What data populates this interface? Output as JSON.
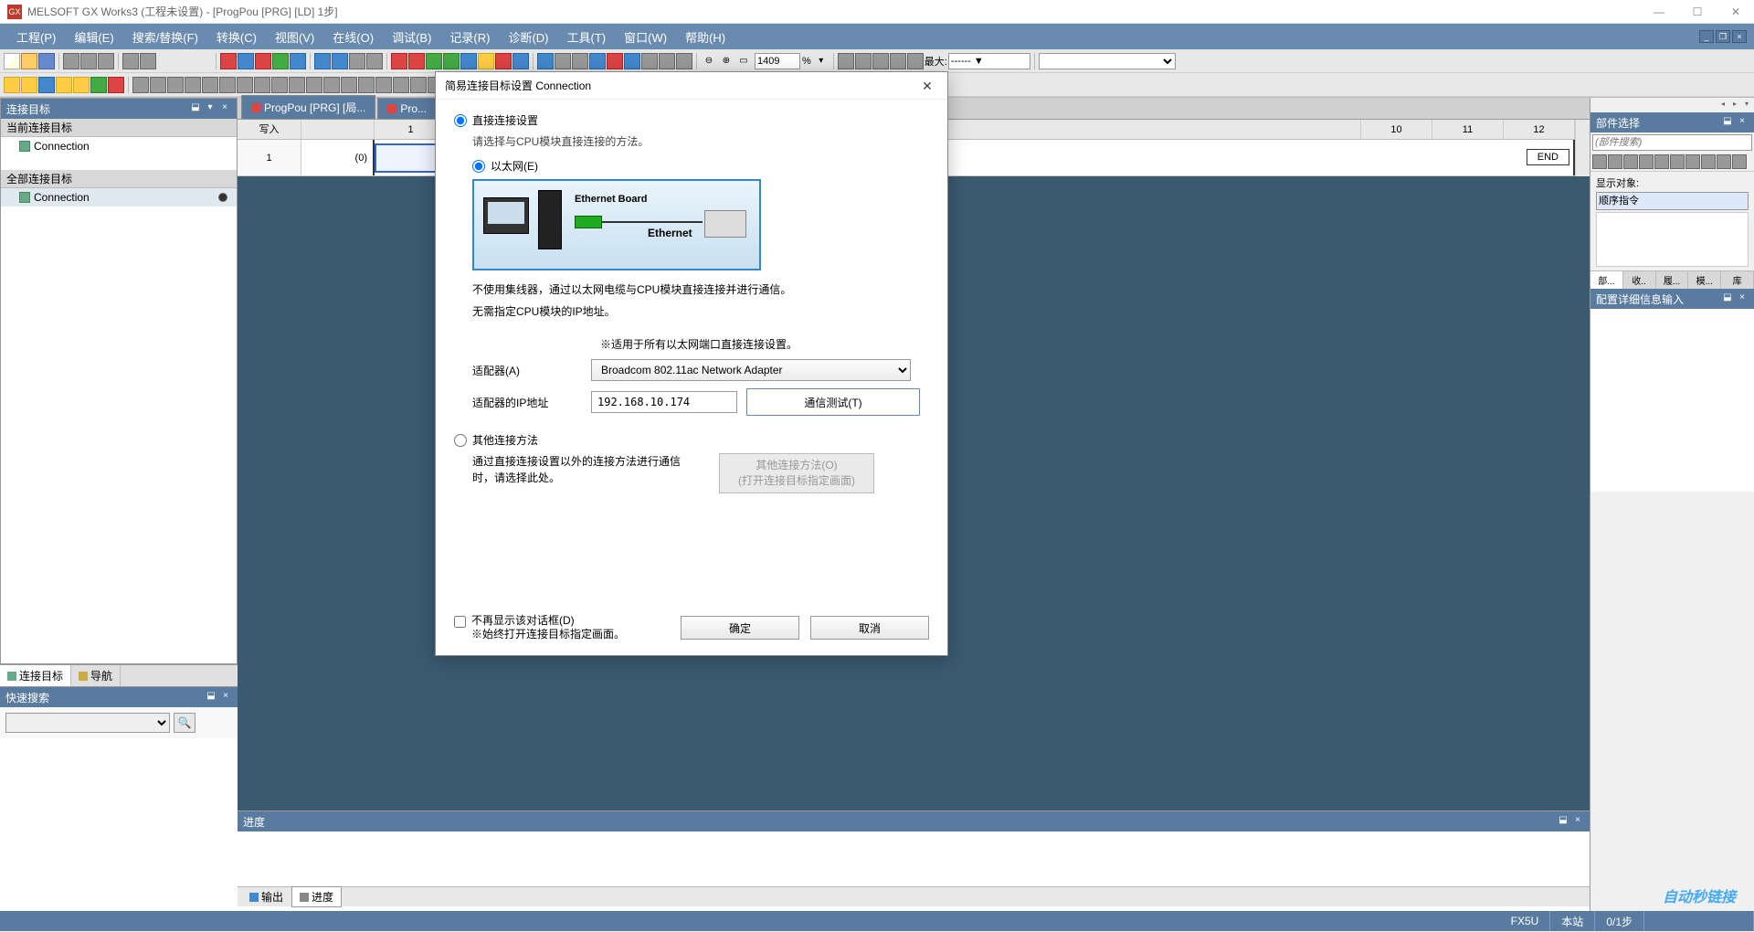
{
  "titlebar": {
    "app_icon": "GX",
    "title": "MELSOFT GX Works3 (工程未设置) - [ProgPou [PRG] [LD] 1步]"
  },
  "menu": {
    "items": [
      "工程(P)",
      "编辑(E)",
      "搜索/替换(F)",
      "转换(C)",
      "视图(V)",
      "在线(O)",
      "调试(B)",
      "记录(R)",
      "诊断(D)",
      "工具(T)",
      "窗口(W)",
      "帮助(H)"
    ]
  },
  "toolbar": {
    "zoom_value": "1409",
    "zoom_suffix": "%",
    "max_label": "最大:",
    "max_value": "------ ▼"
  },
  "left": {
    "conn_panel_title": "连接目标",
    "current_label": "当前连接目标",
    "current_item": "Connection",
    "all_label": "全部连接目标",
    "all_item": "Connection",
    "tab_conn": "连接目标",
    "tab_nav": "导航",
    "quick_title": "快速搜索"
  },
  "center": {
    "tab1": "ProgPou [PRG] [局...",
    "tab2": "Pro...",
    "write_label": "写入",
    "col_1": "1",
    "col_10": "10",
    "col_11": "11",
    "col_12": "12",
    "row_num": "1",
    "rung_num": "(0)",
    "end_label": "END",
    "progress_title": "进度",
    "output_tab": "输出",
    "progress_tab": "进度"
  },
  "right": {
    "parts_title": "部件选择",
    "search_placeholder": "(部件搜索)",
    "display_label": "显示对象:",
    "display_value": "顺序指令",
    "bottom_tabs": [
      "部...",
      "收..",
      "履...",
      "模...",
      "库"
    ],
    "config_title": "配置详细信息输入"
  },
  "status": {
    "fx": "FX5U",
    "station": "本站",
    "step": "0/1步"
  },
  "watermark": "自动秒链接",
  "dialog": {
    "title": "简易连接目标设置 Connection",
    "direct_radio": "直接连接设置",
    "direct_hint": "请选择与CPU模块直接连接的方法。",
    "eth_radio": "以太网(E)",
    "eth_board": "Ethernet Board",
    "eth_name": "Ethernet",
    "desc1": "不使用集线器，通过以太网电缆与CPU模块直接连接并进行通信。",
    "desc2": "无需指定CPU模块的IP地址。",
    "note": "※适用于所有以太网端口直接连接设置。",
    "adapter_label": "适配器(A)",
    "adapter_value": "Broadcom 802.11ac Network Adapter",
    "ip_label": "适配器的IP地址",
    "ip_value": "192.168.10.174",
    "test_btn": "通信测试(T)",
    "other_radio": "其他连接方法",
    "other_desc1": "通过直接连接设置以外的连接方法进行通信时，请选择此处。",
    "other_btn1": "其他连接方法(O)",
    "other_btn2": "(打开连接目标指定画面)",
    "dont_show": "不再显示该对话框(D)",
    "dont_show_note": "※始终打开连接目标指定画面。",
    "ok": "确定",
    "cancel": "取消"
  }
}
